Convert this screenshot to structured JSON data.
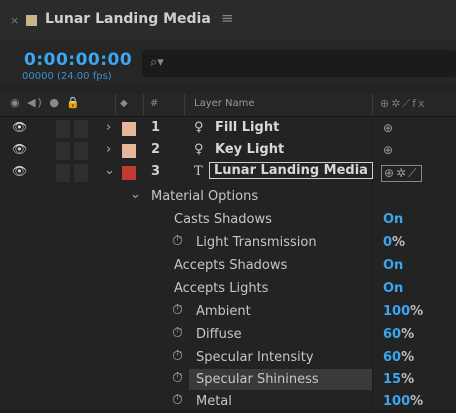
{
  "tab": {
    "title": "Lunar Landing Media",
    "close_glyph": "×",
    "menu_glyph": "≡",
    "swatch_color": "#c9b48a"
  },
  "time": {
    "timecode": "0:00:00:00",
    "fps": "00000 (24.00 fps)"
  },
  "search": {
    "placeholder": "",
    "icon": "search-icon"
  },
  "columns": {
    "layer_name": "Layer Name",
    "number": "#"
  },
  "layers": [
    {
      "number": "1",
      "name": "Fill Light",
      "type_glyph": "💡",
      "label_color": "#e4b89a",
      "expanded": false
    },
    {
      "number": "2",
      "name": "Key Light",
      "type_glyph": "💡",
      "label_color": "#e4b89a",
      "expanded": false
    },
    {
      "number": "3",
      "name": "Lunar Landing Media",
      "type_glyph": "T",
      "label_color": "#c23a34",
      "expanded": true
    }
  ],
  "group": {
    "name": "Material Options"
  },
  "properties": [
    {
      "name": "Casts Shadows",
      "value": "On",
      "unit": "",
      "stopwatch": false
    },
    {
      "name": "Light Transmission",
      "value": "0",
      "unit": "%",
      "stopwatch": true
    },
    {
      "name": "Accepts Shadows",
      "value": "On",
      "unit": "",
      "stopwatch": false
    },
    {
      "name": "Accepts Lights",
      "value": "On",
      "unit": "",
      "stopwatch": false
    },
    {
      "name": "Ambient",
      "value": "100",
      "unit": "%",
      "stopwatch": true
    },
    {
      "name": "Diffuse",
      "value": "60",
      "unit": "%",
      "stopwatch": true
    },
    {
      "name": "Specular Intensity",
      "value": "60",
      "unit": "%",
      "stopwatch": true
    },
    {
      "name": "Specular Shininess",
      "value": "15",
      "unit": "%",
      "stopwatch": true
    },
    {
      "name": "Metal",
      "value": "100",
      "unit": "%",
      "stopwatch": true
    }
  ]
}
